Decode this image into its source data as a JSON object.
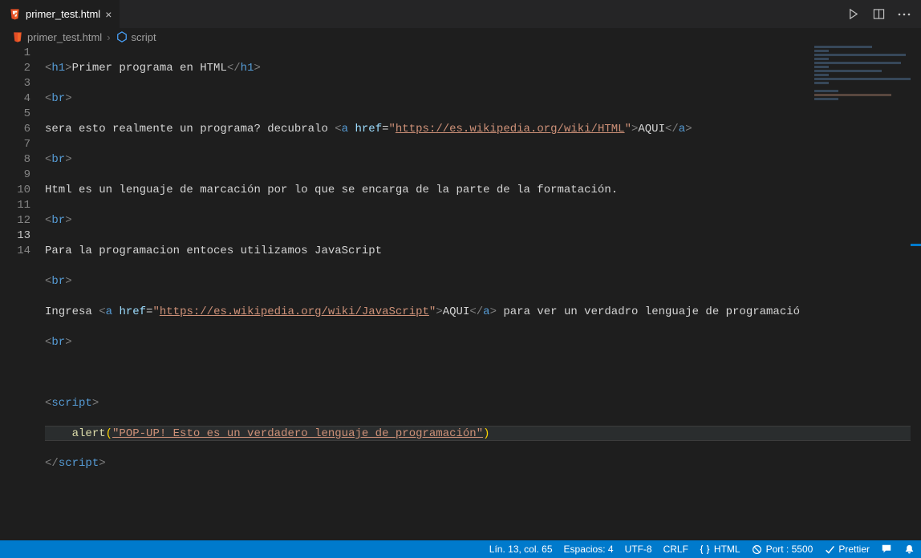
{
  "tab": {
    "filename": "primer_test.html"
  },
  "breadcrumbs": {
    "file": "primer_test.html",
    "symbol": "script"
  },
  "lines": {
    "1": {
      "open": "<",
      "tag": "h1",
      "close": ">",
      "text": "Primer programa en HTML",
      "open2": "</",
      "close2": ">"
    },
    "2": {
      "open": "<",
      "tag": "br",
      "close": ">"
    },
    "3": {
      "pre": "sera esto realmente un programa? decubralo ",
      "open": "<",
      "tag": "a",
      "sp": " ",
      "attr": "href",
      "eq": "=",
      "q1": "\"",
      "url": "https://es.wikipedia.org/wiki/HTML",
      "q2": "\"",
      "close": ">",
      "inner": "AQUI",
      "open2": "</",
      "close2": ">"
    },
    "4": {
      "open": "<",
      "tag": "br",
      "close": ">"
    },
    "5": {
      "text": "Html es un lenguaje de marcación por lo que se encarga de la parte de la formatación."
    },
    "6": {
      "open": "<",
      "tag": "br",
      "close": ">"
    },
    "7": {
      "text": "Para la programacion entoces utilizamos JavaScript"
    },
    "8": {
      "open": "<",
      "tag": "br",
      "close": ">"
    },
    "9": {
      "pre": "Ingresa ",
      "open": "<",
      "tag": "a",
      "sp": " ",
      "attr": "href",
      "eq": "=",
      "q1": "\"",
      "url": "https://es.wikipedia.org/wiki/JavaScript",
      "q2": "\"",
      "close": ">",
      "inner": "AQUI",
      "open2": "</",
      "close2": ">",
      "post": " para ver un verdadro lenguaje de programació"
    },
    "10": {
      "open": "<",
      "tag": "br",
      "close": ">"
    },
    "12": {
      "open": "<",
      "tag": "script",
      "close": ">"
    },
    "13": {
      "indent": "    ",
      "func": "alert",
      "lp": "(",
      "str": "\"POP-UP! Esto es un verdadero lenguaje de programación\"",
      "rp": ")"
    },
    "14": {
      "open": "</",
      "tag": "script",
      "close": ">"
    }
  },
  "status": {
    "cursor": "Lín. 13, col. 65",
    "spaces": "Espacios: 4",
    "encoding": "UTF-8",
    "eol": "CRLF",
    "lang": "HTML",
    "port": "Port : 5500",
    "formatter": "Prettier"
  }
}
